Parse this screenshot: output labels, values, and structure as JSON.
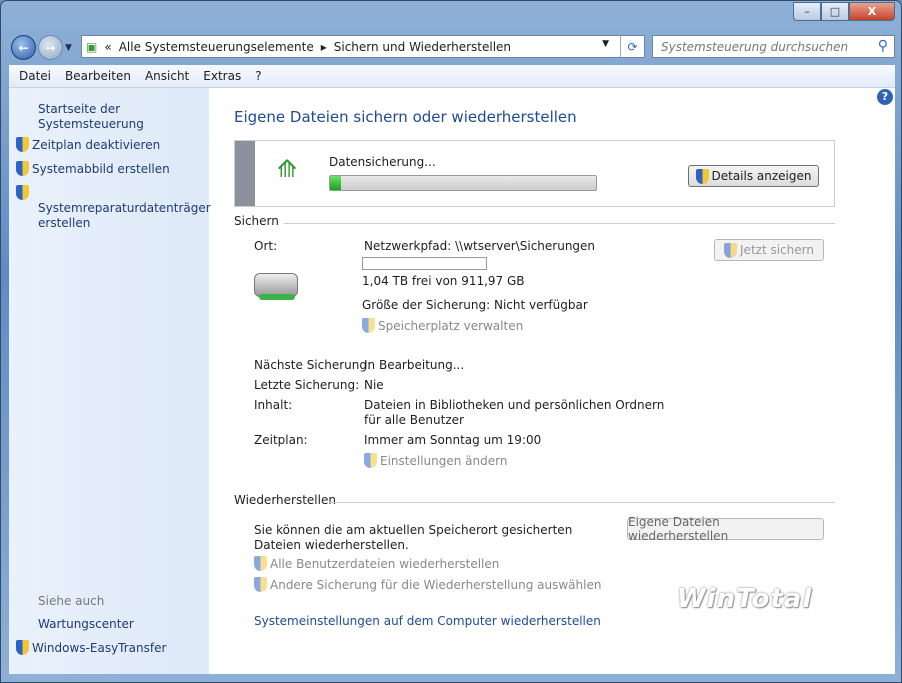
{
  "window": {
    "controls": {
      "minimize": "–",
      "maximize": "□",
      "close": "X"
    }
  },
  "nav": {
    "back": "←",
    "forward": "→"
  },
  "address": {
    "overflow": "«",
    "segments": [
      "Alle Systemsteuerungselemente",
      "Sichern und Wiederherstellen"
    ],
    "separator": "▸"
  },
  "search": {
    "placeholder": "Systemsteuerung durchsuchen"
  },
  "menu": [
    "Datei",
    "Bearbeiten",
    "Ansicht",
    "Extras",
    "?"
  ],
  "sidebar": {
    "home": "Startseite der Systemsteuerung",
    "tasks": [
      "Zeitplan deaktivieren",
      "Systemabbild erstellen",
      "Systemreparaturdatenträger erstellen"
    ],
    "see_also_heading": "Siehe auch",
    "see_also": [
      "Wartungscenter",
      "Windows-EasyTransfer"
    ]
  },
  "main": {
    "title": "Eigene Dateien sichern oder wiederherstellen",
    "progress": {
      "label": "Datensicherung...",
      "percent": 4,
      "details_button": "Details anzeigen"
    },
    "backup": {
      "heading": "Sichern",
      "location_label": "Ort:",
      "location_value": "Netzwerkpfad: \\\\wtserver\\Sicherungen",
      "free_space": "1,04 TB frei von 911,97 GB",
      "backup_size": "Größe der Sicherung: Nicht verfügbar",
      "manage_space": "Speicherplatz verwalten",
      "backup_now": "Jetzt sichern",
      "next_label": "Nächste Sicherung:",
      "next_value": "In Bearbeitung...",
      "last_label": "Letzte Sicherung:",
      "last_value": "Nie",
      "content_label": "Inhalt:",
      "content_value": "Dateien in Bibliotheken und persönlichen Ordnern für alle Benutzer",
      "schedule_label": "Zeitplan:",
      "schedule_value": "Immer am Sonntag um 19:00",
      "change_settings": "Einstellungen ändern"
    },
    "restore": {
      "heading": "Wiederherstellen",
      "text": "Sie können die am aktuellen Speicherort gesicherten Dateien wiederherstellen.",
      "restore_button": "Eigene Dateien wiederherstellen",
      "all_users": "Alle Benutzerdateien wiederherstellen",
      "other_backup": "Andere Sicherung für die Wiederherstellung auswählen",
      "system_settings": "Systemeinstellungen auf dem Computer wiederherstellen"
    },
    "watermark": "WinTotal"
  }
}
